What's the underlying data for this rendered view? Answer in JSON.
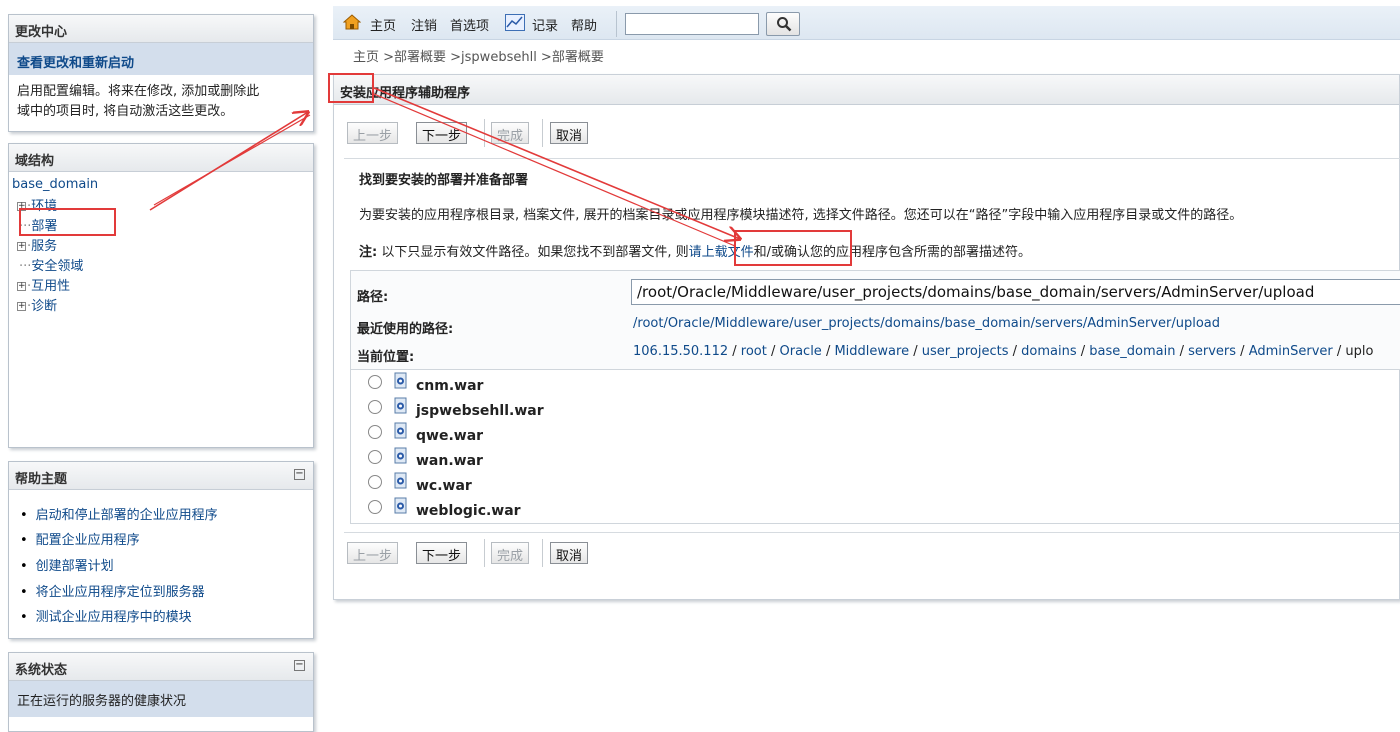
{
  "change_center": {
    "title": "更改中心",
    "link": "查看更改和重新启动",
    "desc_line1": "启用配置编辑。将来在修改, 添加或删除此",
    "desc_line2": "域中的项目时, 将自动激活这些更改。"
  },
  "domain_structure": {
    "title": "域结构",
    "root": "base_domain",
    "items": [
      {
        "label": "环境",
        "expandable": true
      },
      {
        "label": "部署",
        "expandable": false
      },
      {
        "label": "服务",
        "expandable": true
      },
      {
        "label": "安全领域",
        "expandable": false
      },
      {
        "label": "互用性",
        "expandable": true
      },
      {
        "label": "诊断",
        "expandable": true
      }
    ]
  },
  "help_topics": {
    "title": "帮助主题",
    "items": [
      "启动和停止部署的企业应用程序",
      "配置企业应用程序",
      "创建部署计划",
      "将企业应用程序定位到服务器",
      "测试企业应用程序中的模块"
    ]
  },
  "system_status": {
    "title": "系统状态",
    "subtitle": "正在运行的服务器的健康状况"
  },
  "topnav": {
    "home": "主页",
    "logout": "注销",
    "prefs": "首选项",
    "record": "记录",
    "help": "帮助",
    "search_value": ""
  },
  "breadcrumb": "主页 >部署概要 >jspwebsehll >部署概要",
  "assistant": {
    "title": "安装应用程序辅助程序",
    "buttons": {
      "back": "上一步",
      "next": "下一步",
      "finish": "完成",
      "cancel": "取消"
    },
    "heading": "找到要安装的部署并准备部署",
    "desc": "为要安装的应用程序根目录, 档案文件, 展开的档案目录或应用程序模块描述符, 选择文件路径。您还可以在“路径”字段中输入应用程序目录或文件的路径。",
    "note_label": "注:",
    "note_pre": " 以下只显示有效文件路径。如果您找不到部署文件, 则",
    "note_link": "请上载文件",
    "note_post": "和/或确认您的应用程序包含所需的部署描述符。",
    "path_label": "路径:",
    "path_value": "/root/Oracle/Middleware/user_projects/domains/base_domain/servers/AdminServer/upload",
    "recent_label": "最近使用的路径:",
    "recent_value": "/root/Oracle/Middleware/user_projects/domains/base_domain/servers/AdminServer/upload",
    "current_label": "当前位置:",
    "current_parts": [
      "106.15.50.112",
      "root",
      "Oracle",
      "Middleware",
      "user_projects",
      "domains",
      "base_domain",
      "servers",
      "AdminServer"
    ],
    "current_last": "uplo",
    "files": [
      "cnm.war",
      "jspwebsehll.war",
      "qwe.war",
      "wan.war",
      "wc.war",
      "weblogic.war"
    ]
  },
  "colors": {
    "link": "#0f4a8a",
    "annotation": "#e23a3a"
  }
}
